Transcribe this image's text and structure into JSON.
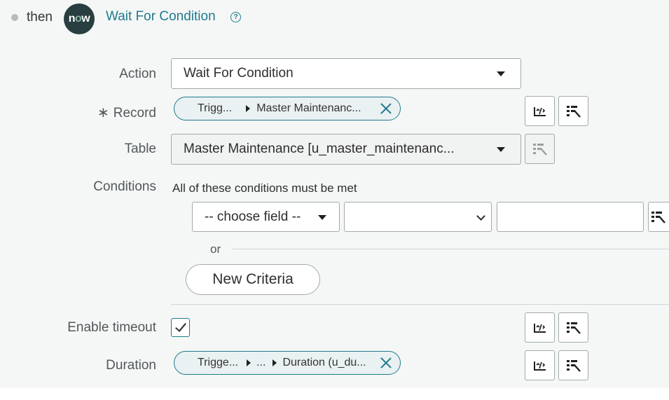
{
  "header": {
    "connector": "then",
    "logo_text": "now",
    "step_title": "Wait For Condition",
    "help_symbol": "?"
  },
  "fields": {
    "action": {
      "label": "Action",
      "value": "Wait For Condition"
    },
    "record": {
      "label": "Record",
      "required_marker": "∗",
      "pill": {
        "first": "Trigg...",
        "last": "Master Maintenanc..."
      }
    },
    "table": {
      "label": "Table",
      "value": "Master Maintenance [u_master_maintenanc..."
    },
    "conditions": {
      "label": "Conditions",
      "description": "All of these conditions must be met",
      "field_select": "-- choose field --",
      "operator_select": "",
      "value_input": "",
      "or_label": "or",
      "new_criteria": "New Criteria"
    },
    "enable_timeout": {
      "label": "Enable timeout",
      "checked": true
    },
    "duration": {
      "label": "Duration",
      "pill": {
        "first": "Trigge...",
        "middle": "...",
        "last": "Duration (u_du..."
      }
    }
  },
  "icons": [
    "help-icon",
    "script-icon",
    "data-pill-picker-icon",
    "close-icon",
    "dropdown-caret-icon",
    "chevron-down-icon",
    "checkmark-icon"
  ],
  "colors": {
    "accent": "#1f7a8c",
    "logo_bg": "#293e40",
    "panel_bg": "#f5f7f7"
  }
}
